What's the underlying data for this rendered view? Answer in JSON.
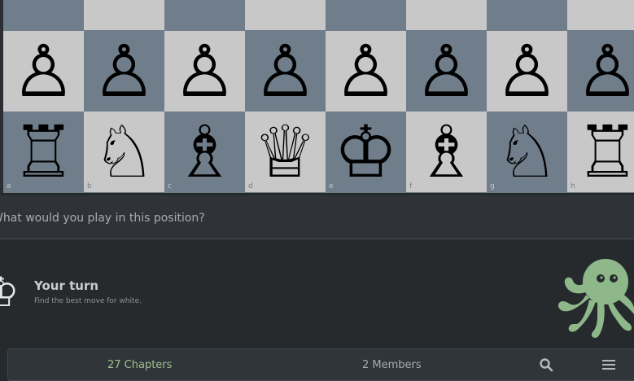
{
  "board": {
    "files": [
      "a",
      "b",
      "c",
      "d",
      "e",
      "f",
      "g",
      "h"
    ],
    "rank2": [
      "♙",
      "♙",
      "♙",
      "♙",
      "♙",
      "♙",
      "♙",
      "♙"
    ],
    "rank1": [
      "♖",
      "♘",
      "♗",
      "♕",
      "♔",
      "♗",
      "♘",
      "♖"
    ]
  },
  "question": {
    "text": "What would you play in this position?"
  },
  "turn": {
    "icon": "white-king-icon",
    "king_glyph": "♔",
    "title": "Your turn",
    "subtitle": "Find the best move for white."
  },
  "mascot": {
    "icon": "octopus-icon",
    "color": "#8fb88a"
  },
  "tabs": {
    "chapters": "27 Chapters",
    "members": "2 Members",
    "search_icon": "search-icon",
    "menu_icon": "hamburger-menu-icon"
  },
  "colors": {
    "light_square": "#c8c8c8",
    "dark_square": "#707d8a",
    "background": "#262a2d",
    "accent": "#9fc18e"
  }
}
